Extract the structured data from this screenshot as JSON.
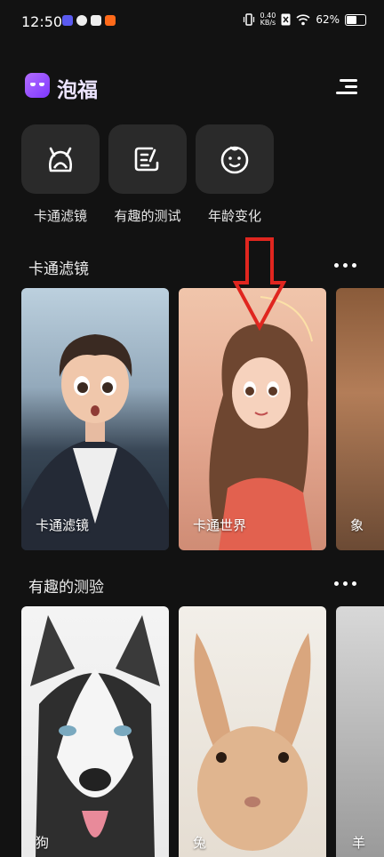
{
  "status": {
    "time": "12:50",
    "net_speed_value": "0.40",
    "net_speed_unit": "KB/s",
    "battery": "62%",
    "battery_level": 0.62
  },
  "header": {
    "brand": "泡福",
    "logo_icon": "ghost-face-icon",
    "menu_icon": "menu-icon"
  },
  "quick_actions": [
    {
      "label": "卡通滤镜",
      "icon": "cartoon-face-icon"
    },
    {
      "label": "有趣的测试",
      "icon": "edit-icon"
    },
    {
      "label": "年龄变化",
      "icon": "baby-face-icon"
    }
  ],
  "sections": [
    {
      "title": "卡通滤镜",
      "cards": [
        {
          "label": "卡通滤镜"
        },
        {
          "label": "卡通世界"
        },
        {
          "label": "象"
        }
      ]
    },
    {
      "title": "有趣的测验",
      "cards": [
        {
          "label": "狗"
        },
        {
          "label": "兔"
        },
        {
          "label": "羊"
        }
      ]
    }
  ],
  "colors": {
    "background": "#121212",
    "tile": "#2a2a2a",
    "accent": "#8b45ff",
    "arrow": "#e0261f"
  }
}
